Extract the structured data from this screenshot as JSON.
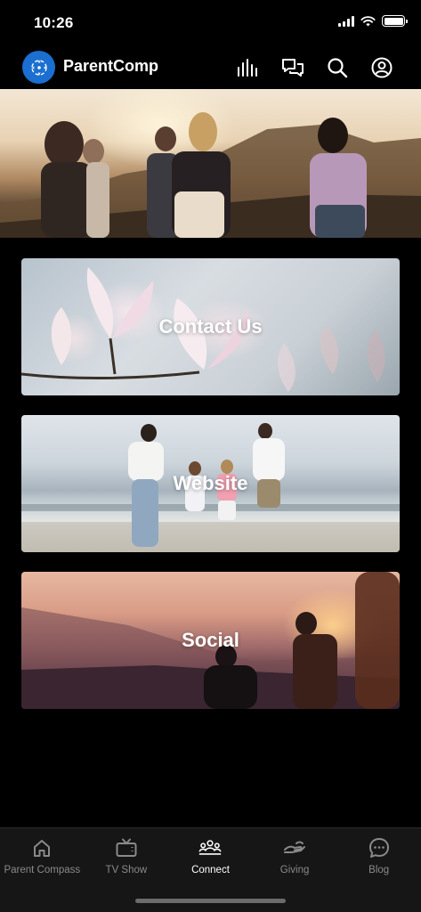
{
  "status_bar": {
    "time": "10:26"
  },
  "header": {
    "title": "ParentComp",
    "icons": [
      "equalizer-icon",
      "chat-icon",
      "search-icon",
      "profile-icon"
    ]
  },
  "cards": [
    {
      "label": "Contact Us"
    },
    {
      "label": "Website"
    },
    {
      "label": "Social"
    }
  ],
  "bottom_nav": {
    "active": "Connect",
    "items": [
      {
        "label": "Parent Compass",
        "icon": "home-icon"
      },
      {
        "label": "TV Show",
        "icon": "tv-icon"
      },
      {
        "label": "Connect",
        "icon": "group-icon"
      },
      {
        "label": "Giving",
        "icon": "giving-hand-icon"
      },
      {
        "label": "Blog",
        "icon": "chat-bubble-icon"
      }
    ]
  },
  "colors": {
    "accent": "#1a6fd0",
    "background": "#000000",
    "nav_bg": "#161616",
    "inactive": "#8a8a8a"
  }
}
